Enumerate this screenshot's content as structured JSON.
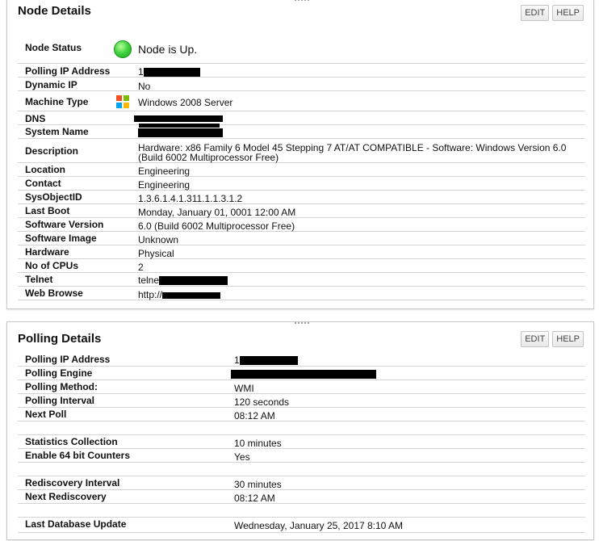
{
  "node_details": {
    "title": "Node Details",
    "edit_label": "EDIT",
    "help_label": "HELP",
    "rows": [
      {
        "label": "Node Status",
        "value": "Node is Up."
      },
      {
        "label": "Polling IP Address",
        "value": "1"
      },
      {
        "label": "Dynamic IP",
        "value": "No"
      },
      {
        "label": "Machine Type",
        "value": "Windows 2008 Server"
      },
      {
        "label": "DNS",
        "value": ""
      },
      {
        "label": "System Name",
        "value": ""
      },
      {
        "label": "Description",
        "value": "Hardware: x86 Family 6 Model 45 Stepping 7 AT/AT COMPATIBLE - Software: Windows Version 6.0",
        "value2": "(Build 6002 Multiprocessor Free)"
      },
      {
        "label": "Location",
        "value": "Engineering"
      },
      {
        "label": "Contact",
        "value": "Engineering"
      },
      {
        "label": "SysObjectID",
        "value": "1.3.6.1.4.1.311.1.1.3.1.2"
      },
      {
        "label": "Last Boot",
        "value": "Monday, January 01, 0001 12:00 AM"
      },
      {
        "label": "Software Version",
        "value": "6.0 (Build 6002 Multiprocessor Free)"
      },
      {
        "label": "Software Image",
        "value": "Unknown"
      },
      {
        "label": "Hardware",
        "value": "Physical"
      },
      {
        "label": "No of CPUs",
        "value": "2"
      },
      {
        "label": "Telnet",
        "value": "telne"
      },
      {
        "label": "Web Browse",
        "value": "http://"
      }
    ]
  },
  "polling_details": {
    "title": "Polling Details",
    "edit_label": "EDIT",
    "help_label": "HELP",
    "rows": [
      {
        "label": "Polling IP Address",
        "value": "1"
      },
      {
        "label": "Polling Engine",
        "value": ""
      },
      {
        "label": "Polling Method:",
        "value": "WMI"
      },
      {
        "label": "Polling Interval",
        "value": "120 seconds"
      },
      {
        "label": "Next Poll",
        "value": "08:12 AM"
      },
      {
        "label": "Statistics Collection",
        "value": "10 minutes"
      },
      {
        "label": "Enable 64 bit Counters",
        "value": "Yes"
      },
      {
        "label": "Rediscovery Interval",
        "value": "30 minutes"
      },
      {
        "label": "Next Rediscovery",
        "value": "08:12 AM"
      },
      {
        "label": "Last Database Update",
        "value": "Wednesday, January 25, 2017 8:10 AM"
      }
    ]
  },
  "colors": {
    "status_up": "#3ed23e",
    "redaction": "#000000"
  },
  "icons": {
    "status": "green-circle-icon",
    "machine_type": "windows-logo-icon"
  }
}
